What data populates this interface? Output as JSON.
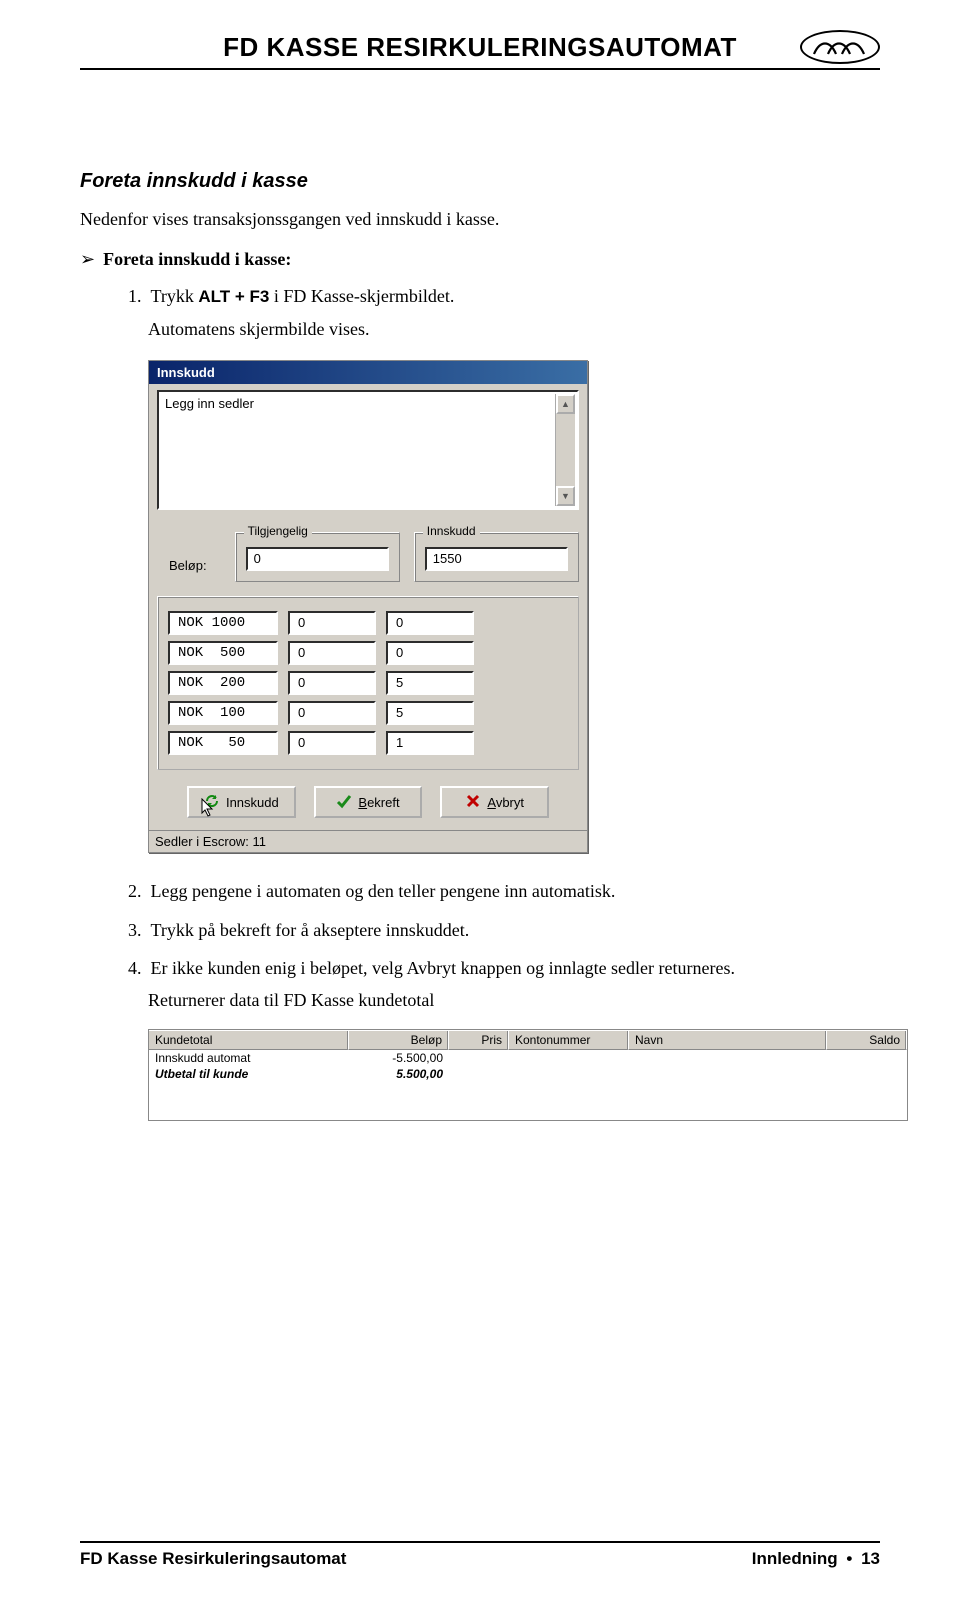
{
  "header": {
    "title": "FD KASSE RESIRKULERINGSAUTOMAT"
  },
  "section": {
    "heading": "Foreta innskudd i kasse",
    "intro": "Nedenfor vises transaksjonssgangen ved innskudd i kasse.",
    "bullet": "Foreta innskudd i kasse:",
    "step1a": "Trykk ",
    "step1_key": "ALT + F3",
    "step1b": " i FD Kasse-skjermbildet.",
    "step1_sub": "Automatens skjermbilde vises.",
    "step2": "Legg pengene i automaten og den teller pengene inn automatisk.",
    "step3": "Trykk på bekreft for å akseptere innskuddet.",
    "step4": "Er ikke kunden enig i beløpet, velg Avbryt knappen og innlagte sedler returneres.",
    "step4_sub": "Returnerer data til FD Kasse kundetotal"
  },
  "dialog": {
    "title": "Innskudd",
    "textarea": "Legg inn sedler",
    "belop_label": "Beløp:",
    "fs_tilgjengelig": "Tilgjengelig",
    "fs_innskudd": "Innskudd",
    "val_tilgjengelig": "0",
    "val_innskudd": "1550",
    "denoms": [
      {
        "label": "NOK 1000",
        "avail": "0",
        "dep": "0"
      },
      {
        "label": "NOK  500",
        "avail": "0",
        "dep": "0"
      },
      {
        "label": "NOK  200",
        "avail": "0",
        "dep": "5"
      },
      {
        "label": "NOK  100",
        "avail": "0",
        "dep": "5"
      },
      {
        "label": "NOK   50",
        "avail": "0",
        "dep": "1"
      }
    ],
    "btn_innskudd": "Innskudd",
    "btn_bekreft": "Bekreft",
    "btn_avbryt": "Avbryt",
    "status": "Sedler i Escrow: 11"
  },
  "kundetotal": {
    "headers": {
      "c1": "Kundetotal",
      "c2": "Beløp",
      "c3": "Pris",
      "c4": "Kontonummer",
      "c5": "Navn",
      "c6": "Saldo"
    },
    "rows": [
      {
        "c1": "Innskudd automat",
        "c2": "-5.500,00",
        "bold": false
      },
      {
        "c1": "Utbetal til kunde",
        "c2": "5.500,00",
        "bold": true
      }
    ]
  },
  "footer": {
    "left": "FD Kasse Resirkuleringsautomat",
    "right_section": "Innledning",
    "right_page": "13"
  }
}
